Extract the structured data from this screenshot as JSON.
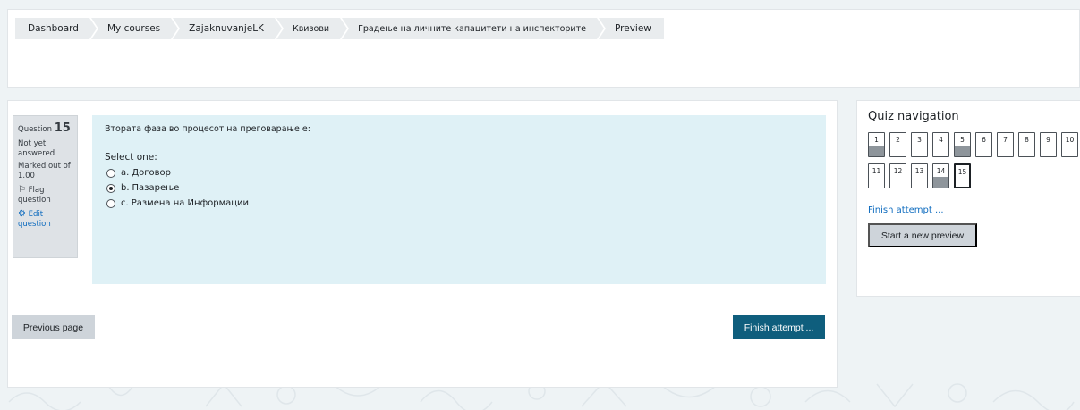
{
  "breadcrumb": [
    {
      "label": "Dashboard"
    },
    {
      "label": "My courses"
    },
    {
      "label": "ZajaknuvanjeLK"
    },
    {
      "label": "Квизови"
    },
    {
      "label": "Градење на личните капацитети на инспекторите"
    },
    {
      "label": "Preview"
    }
  ],
  "question_info": {
    "prefix": "Question",
    "number": "15",
    "state": "Not yet answered",
    "marked": "Marked out of 1.00",
    "flag_label": "Flag question",
    "edit_label": "Edit question"
  },
  "question": {
    "text": "Втората фаза во процесот на преговарање е:",
    "prompt": "Select one:",
    "options": [
      {
        "letter": "a.",
        "text": "Договор",
        "selected": false
      },
      {
        "letter": "b.",
        "text": "Пазарење",
        "selected": true
      },
      {
        "letter": "c.",
        "text": "Размена на Информации",
        "selected": false
      }
    ]
  },
  "buttons": {
    "previous": "Previous page",
    "finish": "Finish attempt ..."
  },
  "quiz_nav": {
    "title": "Quiz navigation",
    "questions": [
      {
        "n": "1",
        "answered": true,
        "current": false
      },
      {
        "n": "2",
        "answered": false,
        "current": false
      },
      {
        "n": "3",
        "answered": false,
        "current": false
      },
      {
        "n": "4",
        "answered": false,
        "current": false
      },
      {
        "n": "5",
        "answered": true,
        "current": false
      },
      {
        "n": "6",
        "answered": false,
        "current": false
      },
      {
        "n": "7",
        "answered": false,
        "current": false
      },
      {
        "n": "8",
        "answered": false,
        "current": false
      },
      {
        "n": "9",
        "answered": false,
        "current": false
      },
      {
        "n": "10",
        "answered": false,
        "current": false
      },
      {
        "n": "11",
        "answered": false,
        "current": false
      },
      {
        "n": "12",
        "answered": false,
        "current": false
      },
      {
        "n": "13",
        "answered": false,
        "current": false
      },
      {
        "n": "14",
        "answered": true,
        "current": false
      },
      {
        "n": "15",
        "answered": false,
        "current": true
      }
    ],
    "finish_link": "Finish attempt ...",
    "new_preview": "Start a new preview"
  },
  "colors": {
    "accent": "#0f5e7d",
    "link": "#0f6cbf",
    "question_bg": "#dff1f6",
    "answered_fill": "#8e959b"
  }
}
